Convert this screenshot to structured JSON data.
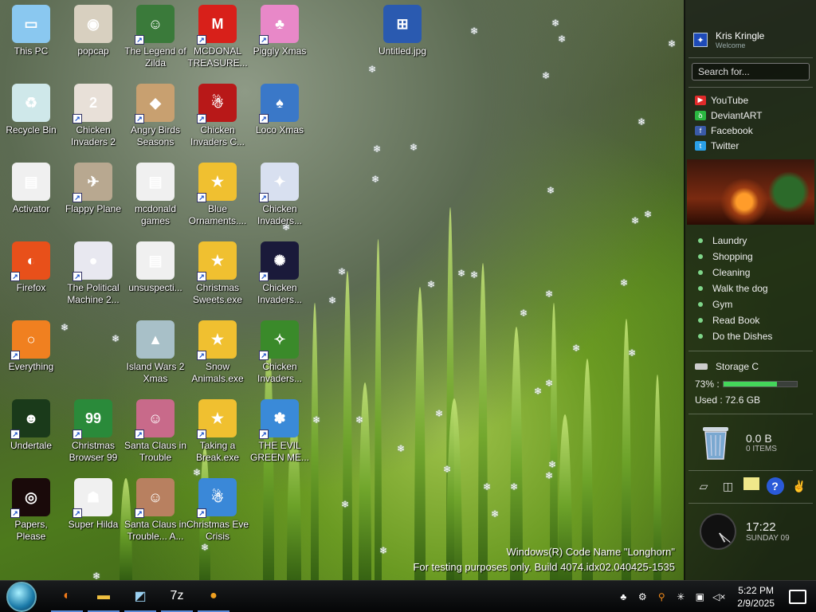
{
  "desktop": {
    "icons": [
      {
        "label": "This PC",
        "color": "#8ac8f0",
        "glyph": "▭",
        "shortcut": false,
        "col": 0,
        "row": 0
      },
      {
        "label": "popcap",
        "color": "#d8d0c0",
        "glyph": "◉",
        "shortcut": false,
        "col": 1,
        "row": 0
      },
      {
        "label": "The Legend of Zilda",
        "color": "#3a7a3a",
        "glyph": "☺",
        "shortcut": true,
        "col": 2,
        "row": 0
      },
      {
        "label": "MCDONAL TREASURE...",
        "color": "#d8201a",
        "glyph": "M",
        "shortcut": true,
        "col": 3,
        "row": 0
      },
      {
        "label": "Piggly Xmas",
        "color": "#e888c8",
        "glyph": "♣",
        "shortcut": true,
        "col": 4,
        "row": 0
      },
      {
        "label": "Untitled.jpg",
        "color": "#2a5ab0",
        "glyph": "⊞",
        "shortcut": false,
        "col": 6,
        "row": 0
      },
      {
        "label": "Recycle Bin",
        "color": "#cfe8ea",
        "glyph": "♻",
        "shortcut": false,
        "col": 0,
        "row": 1
      },
      {
        "label": "Chicken Invaders 2",
        "color": "#e8e0d8",
        "glyph": "2",
        "shortcut": true,
        "col": 1,
        "row": 1
      },
      {
        "label": "Angry Birds Seasons",
        "color": "#c8a070",
        "glyph": "◆",
        "shortcut": true,
        "col": 2,
        "row": 1
      },
      {
        "label": "Chicken Invaders C...",
        "color": "#b81818",
        "glyph": "☃",
        "shortcut": true,
        "col": 3,
        "row": 1
      },
      {
        "label": "Loco Xmas",
        "color": "#3a78c8",
        "glyph": "♠",
        "shortcut": true,
        "col": 4,
        "row": 1
      },
      {
        "label": "Activator",
        "color": "#f0f0f0",
        "glyph": "▤",
        "shortcut": false,
        "col": 0,
        "row": 2
      },
      {
        "label": "Flappy Plane",
        "color": "#b8a890",
        "glyph": "✈",
        "shortcut": true,
        "col": 1,
        "row": 2
      },
      {
        "label": "mcdonald games",
        "color": "#f0f0f0",
        "glyph": "▤",
        "shortcut": false,
        "col": 2,
        "row": 2
      },
      {
        "label": "Blue Ornaments....",
        "color": "#f0c030",
        "glyph": "★",
        "shortcut": true,
        "col": 3,
        "row": 2
      },
      {
        "label": "Chicken Invaders...",
        "color": "#d8e0f0",
        "glyph": "✦",
        "shortcut": true,
        "col": 4,
        "row": 2
      },
      {
        "label": "Firefox",
        "color": "#e8501a",
        "glyph": "◐",
        "shortcut": true,
        "col": 0,
        "row": 3
      },
      {
        "label": "The Political Machine 2...",
        "color": "#e8e8f0",
        "glyph": "●",
        "shortcut": true,
        "col": 1,
        "row": 3
      },
      {
        "label": "unsuspecti...",
        "color": "#f0f0f0",
        "glyph": "▤",
        "shortcut": false,
        "col": 2,
        "row": 3
      },
      {
        "label": "Christmas Sweets.exe",
        "color": "#f0c030",
        "glyph": "★",
        "shortcut": true,
        "col": 3,
        "row": 3
      },
      {
        "label": "Chicken Invaders...",
        "color": "#1a1a3a",
        "glyph": "✺",
        "shortcut": true,
        "col": 4,
        "row": 3
      },
      {
        "label": "Everything",
        "color": "#f08020",
        "glyph": "○",
        "shortcut": true,
        "col": 0,
        "row": 4
      },
      {
        "label": "Island Wars 2 Xmas",
        "color": "#a8c0c8",
        "glyph": "▲",
        "shortcut": false,
        "col": 2,
        "row": 4
      },
      {
        "label": "Snow Animals.exe",
        "color": "#f0c030",
        "glyph": "★",
        "shortcut": true,
        "col": 3,
        "row": 4
      },
      {
        "label": "Chicken Invaders...",
        "color": "#3a8a2a",
        "glyph": "✧",
        "shortcut": true,
        "col": 4,
        "row": 4
      },
      {
        "label": "Undertale",
        "color": "#1a3a1a",
        "glyph": "☻",
        "shortcut": true,
        "col": 0,
        "row": 5
      },
      {
        "label": "Christmas Browser 99",
        "color": "#2a8a3a",
        "glyph": "99",
        "shortcut": true,
        "col": 1,
        "row": 5
      },
      {
        "label": "Santa Claus in Trouble",
        "color": "#c86a8a",
        "glyph": "☺",
        "shortcut": true,
        "col": 2,
        "row": 5
      },
      {
        "label": "Taking a Break.exe",
        "color": "#f0c030",
        "glyph": "★",
        "shortcut": true,
        "col": 3,
        "row": 5
      },
      {
        "label": "THE EVIL GREEN ME...",
        "color": "#3a8ad8",
        "glyph": "✽",
        "shortcut": true,
        "col": 4,
        "row": 5
      },
      {
        "label": "Papers, Please",
        "color": "#1a0a0a",
        "glyph": "◎",
        "shortcut": true,
        "col": 0,
        "row": 6
      },
      {
        "label": "Super Hilda",
        "color": "#f0f0f0",
        "glyph": "☗",
        "shortcut": true,
        "col": 1,
        "row": 6
      },
      {
        "label": "Santa Claus in Trouble... A...",
        "color": "#b88060",
        "glyph": "☺",
        "shortcut": true,
        "col": 2,
        "row": 6
      },
      {
        "label": "Christmas Eve Crisis",
        "color": "#3a88d8",
        "glyph": "☃",
        "shortcut": true,
        "col": 3,
        "row": 6
      }
    ],
    "watermark_line1": "Windows(R) Code Name \"Longhorn\"",
    "watermark_line2": "For testing purposes only. Build 4074.idx02.040425-1535"
  },
  "sidebar": {
    "user_name": "Kris Kringle",
    "user_greeting": "Welcome",
    "search_placeholder": "Search for...",
    "links": [
      {
        "label": "YouTube",
        "color": "#e02a2a",
        "glyph": "▶"
      },
      {
        "label": "DeviantART",
        "color": "#2ab840",
        "glyph": "ꝺ"
      },
      {
        "label": "Facebook",
        "color": "#3a5aa8",
        "glyph": "f"
      },
      {
        "label": "Twitter",
        "color": "#2aa0e8",
        "glyph": "t"
      }
    ],
    "todo": [
      "Laundry",
      "Shopping",
      "Cleaning",
      "Walk the dog",
      "Gym",
      "Read Book",
      "Do the Dishes"
    ],
    "storage": {
      "title": "Storage C",
      "percent_label": "73% :",
      "used_fraction": 0.73,
      "used_label": "Used : 72.6 GB"
    },
    "recycle": {
      "size": "0.0 B",
      "items": "0 ITEMS"
    },
    "clock": {
      "time": "17:22",
      "date": "SUNDAY 09"
    }
  },
  "taskbar": {
    "apps": [
      {
        "name": "firefox-icon",
        "glyph": "◐",
        "color": "#f07a1a"
      },
      {
        "name": "file-explorer-icon",
        "glyph": "▬",
        "color": "#f0c040"
      },
      {
        "name": "app-cube-icon",
        "glyph": "◩",
        "color": "#9ad0f0"
      },
      {
        "name": "7zip-icon",
        "glyph": "7z",
        "color": "#fff"
      },
      {
        "name": "droplet-icon",
        "glyph": "●",
        "color": "#f0a020"
      }
    ],
    "time": "5:22 PM",
    "date": "2/9/2025"
  }
}
